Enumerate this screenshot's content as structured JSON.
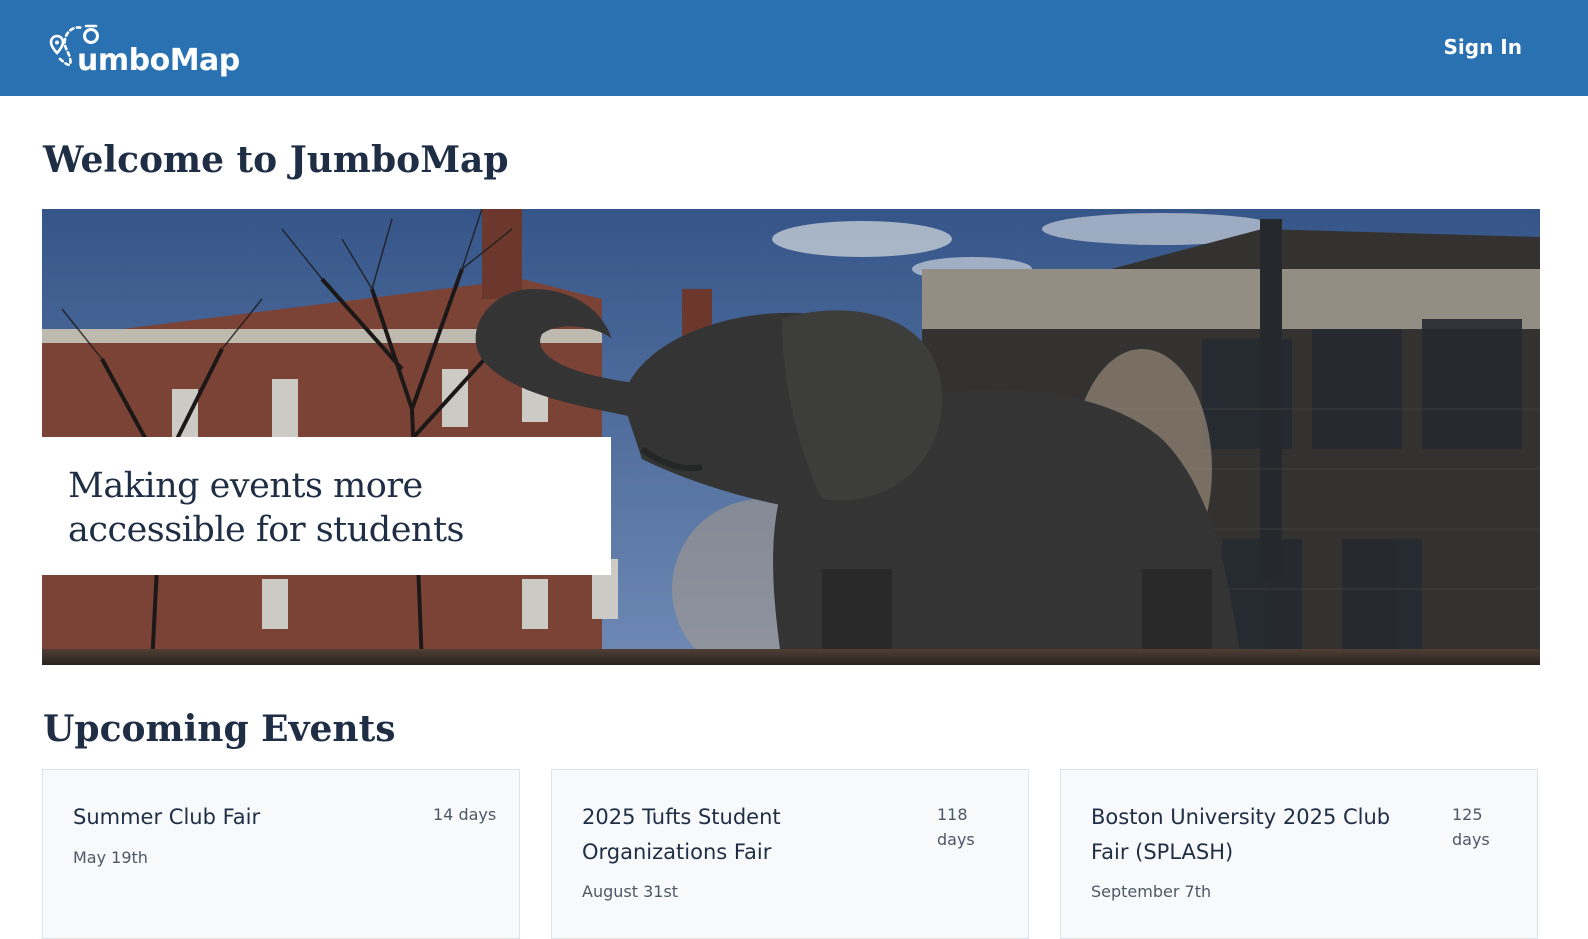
{
  "header": {
    "logo_text": "umboMap",
    "logo_full_name": "JumboMap",
    "sign_in_label": "Sign In"
  },
  "main": {
    "title": "Welcome to JumboMap",
    "hero": {
      "tagline_line1": "Making events more",
      "tagline_line2": "accessible for students",
      "image_subject": "jumbo-elephant-statue-campus-photo"
    },
    "upcoming_title": "Upcoming Events",
    "events": [
      {
        "name": "Summer Club Fair",
        "countdown_value": "14",
        "countdown_unit": "days",
        "date": "May 19th"
      },
      {
        "name": "2025 Tufts Student Organizations Fair",
        "countdown_value": "118",
        "countdown_unit": "days",
        "date": "August 31st"
      },
      {
        "name": "Boston University 2025 Club Fair (SPLASH)",
        "countdown_value": "125",
        "countdown_unit": "days",
        "date": "September 7th"
      }
    ]
  },
  "colors": {
    "header_bg": "#2a71b1",
    "heading_text": "#1f2e45",
    "card_bg": "#f7f9fb",
    "card_border": "#dde3ea"
  },
  "icons": {
    "logo": "map-pin-dotted-path-icon"
  }
}
